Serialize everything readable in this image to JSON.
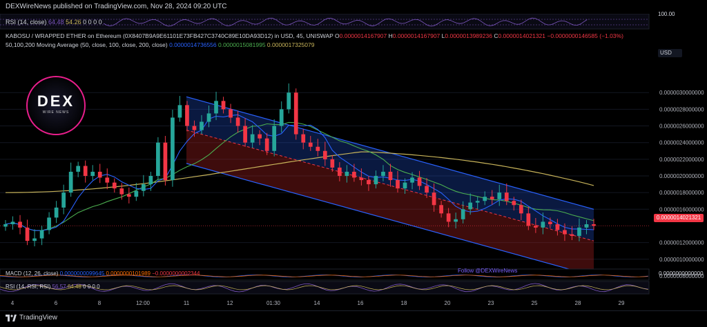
{
  "publisher": "DEXWireNews published on TradingView.com, Nov 28, 2024 09:20 UTC",
  "rsi_top": {
    "label": "RSI (14, close)",
    "value": "64.48",
    "extra": "54.26",
    "zeros": "0 0 0 0",
    "scale_max": "100.00"
  },
  "legend": {
    "pair": "KABOSU / WRAPPED ETHER on Ethereum (0X8407B9A9E61101E73FB427C3740C89E10DA93D12) in USD, 45, UNISWAP",
    "o_label": "O",
    "o": "0.0000014167907",
    "h_label": "H",
    "h": "0.0000014167907",
    "l_label": "L",
    "l": "0.0000013989236",
    "c_label": "C",
    "c": "0.0000014021321",
    "chg": "−0.0000000146585 (−1.03%)",
    "ma_label": "50,100,200 Moving Average (50, close, 100, close, 200, close)",
    "ma50": "0.0000014736556",
    "ma100": "0.0000015081995",
    "ma200": "0.0000017325079"
  },
  "currency": "USD",
  "current_price": "0.0000014021321",
  "watermark_follow": "Follow @DEXWireNews",
  "logo": {
    "text": "DEX",
    "sub": "WIRE NEWS"
  },
  "macd": {
    "label": "MACD (12, 26, close)",
    "v1": "0.0000000099645",
    "v2": "0.0000000101989",
    "v3": "−0.0000000002344",
    "zero": "0.0000000000000"
  },
  "rsi_bottom": {
    "label": "RSI (14, RSI; RSI)",
    "v1": "56.57",
    "v2": "64.48",
    "zeros": "0 0 0 0"
  },
  "footer": {
    "brand": "TradingView"
  },
  "colors": {
    "up": "#26a69a",
    "down": "#f23645",
    "ma50": "#2962ff",
    "ma100": "#4caf50",
    "ma200": "#c8b45a",
    "channel_blue": "#2962ff",
    "channel_red": "#b22222"
  },
  "chart_data": {
    "type": "candlestick",
    "price_axis_ticks": [
      "0.0000030000000",
      "0.0000028000000",
      "0.0000026000000",
      "0.0000024000000",
      "0.0000022000000",
      "0.0000020000000",
      "0.0000018000000",
      "0.0000016000000",
      "0.0000012000000",
      "0.0000010000000",
      "0.0000008000000"
    ],
    "price_axis_range": [
      7e-07,
      3.3e-06
    ],
    "x_labels": [
      "4",
      "6",
      "8",
      "12:00",
      "11",
      "12",
      "01:30",
      "14",
      "16",
      "18",
      "20",
      "23",
      "25",
      "28",
      "29"
    ],
    "close_series": [
      1.42,
      1.45,
      1.38,
      1.22,
      1.25,
      1.35,
      1.5,
      1.62,
      1.8,
      2.05,
      2.12,
      2.0,
      2.05,
      1.98,
      1.92,
      1.85,
      1.78,
      1.75,
      1.82,
      1.9,
      2.0,
      2.4,
      1.95,
      2.7,
      2.85,
      2.6,
      2.55,
      2.65,
      2.75,
      2.9,
      2.8,
      2.7,
      2.6,
      2.4,
      2.5,
      2.45,
      2.3,
      2.6,
      2.8,
      3.0,
      2.5,
      2.4,
      2.35,
      2.3,
      2.2,
      2.1,
      2.0,
      2.05,
      1.98,
      1.95,
      1.9,
      2.0,
      2.05,
      1.95,
      1.85,
      1.92,
      1.98,
      1.88,
      1.8,
      1.65,
      1.55,
      1.45,
      1.48,
      1.6,
      1.68,
      1.7,
      1.75,
      1.72,
      1.8,
      1.7,
      1.65,
      1.55,
      1.4,
      1.38,
      1.45,
      1.42,
      1.35,
      1.3,
      1.28,
      1.38,
      1.42,
      1.4
    ]
  }
}
